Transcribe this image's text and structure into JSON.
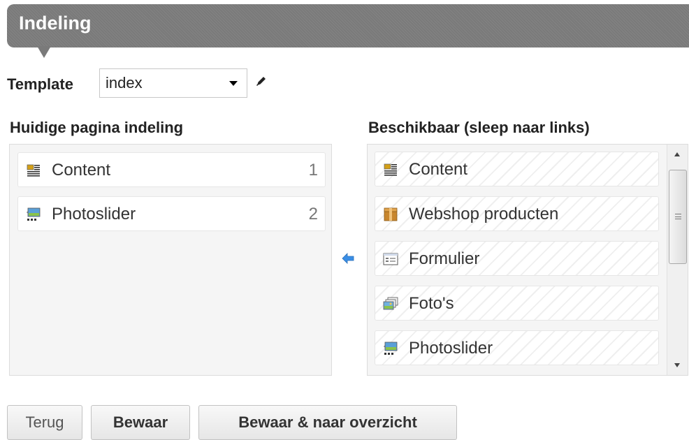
{
  "header": {
    "title": "Indeling"
  },
  "template": {
    "label": "Template",
    "selected": "index"
  },
  "left": {
    "heading": "Huidige pagina indeling",
    "items": [
      {
        "label": "Content",
        "icon": "content-icon",
        "order": "1"
      },
      {
        "label": "Photoslider",
        "icon": "photoslider-icon",
        "order": "2"
      }
    ]
  },
  "right": {
    "heading": "Beschikbaar (sleep naar links)",
    "items": [
      {
        "label": "Content",
        "icon": "content-icon"
      },
      {
        "label": "Webshop producten",
        "icon": "webshop-box-icon"
      },
      {
        "label": "Formulier",
        "icon": "form-icon"
      },
      {
        "label": "Foto's",
        "icon": "photos-icon"
      },
      {
        "label": "Photoslider",
        "icon": "photoslider-icon"
      }
    ]
  },
  "buttons": {
    "back": "Terug",
    "save": "Bewaar",
    "save_overview": "Bewaar & naar overzicht"
  },
  "colors": {
    "header_bg": "#7a7a7a",
    "arrow": "#3a8ee6",
    "panel_bg": "#f5f5f5"
  }
}
